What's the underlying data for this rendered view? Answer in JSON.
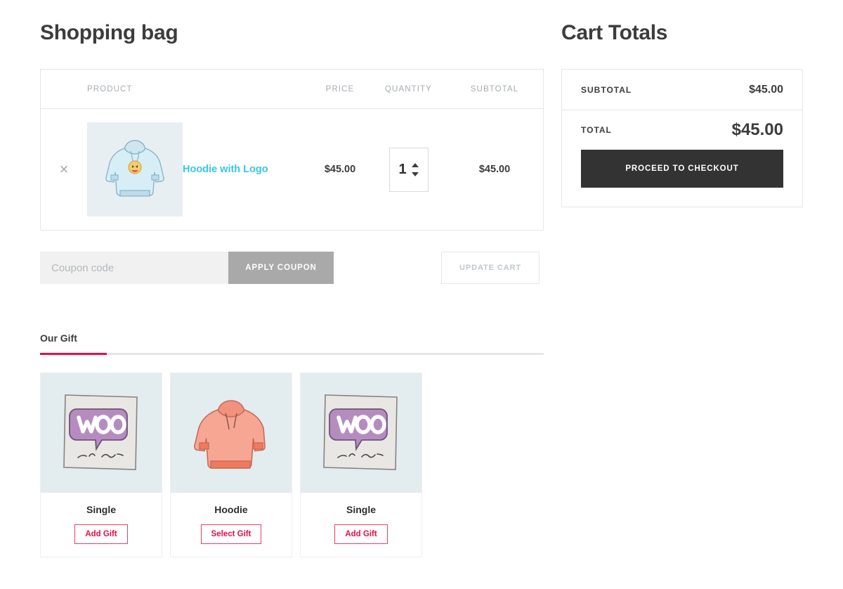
{
  "cart": {
    "title": "Shopping bag",
    "table_headers": {
      "product": "PRODUCT",
      "price": "PRICE",
      "quantity": "QUANTITY",
      "subtotal": "SUBTOTAL"
    },
    "items": [
      {
        "remove_label": "×",
        "image_alt": "hoodie-with-logo-thumbnail",
        "name": "Hoodie with Logo",
        "price": "$45.00",
        "quantity": "1",
        "subtotal": "$45.00"
      }
    ]
  },
  "coupon": {
    "placeholder": "Coupon code",
    "value": "",
    "apply_label": "APPLY COUPON",
    "update_label": "UPDATE CART"
  },
  "gifts": {
    "tab_label": "Our Gift",
    "cards": [
      {
        "name": "Single",
        "button_label": "Add Gift",
        "image_alt": "woo-single-album-art"
      },
      {
        "name": "Hoodie",
        "button_label": "Select Gift",
        "image_alt": "coral-hoodie"
      },
      {
        "name": "Single",
        "button_label": "Add Gift",
        "image_alt": "woo-single-album-art"
      }
    ]
  },
  "totals": {
    "title": "Cart Totals",
    "subtotal_label": "SUBTOTAL",
    "subtotal_value": "$45.00",
    "total_label": "TOTAL",
    "total_value": "$45.00",
    "checkout_label": "PROCEED TO CHECKOUT"
  },
  "colors": {
    "accent_red": "#ea0c45",
    "link_blue": "#39c5ea",
    "dark_button": "#333333",
    "apply_gray": "#a9a9a9",
    "thumb_bg": "#e7eff3",
    "gift_img_bg": "#e3ecef"
  }
}
